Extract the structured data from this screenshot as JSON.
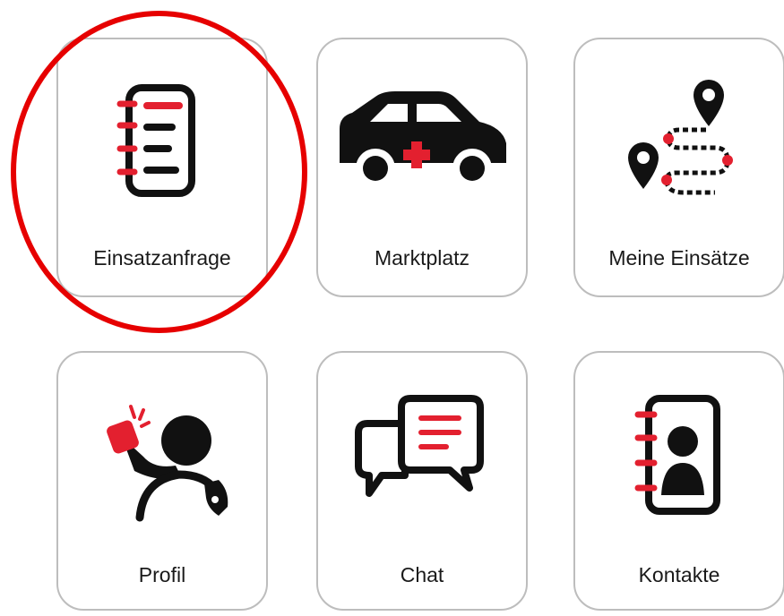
{
  "tiles": [
    {
      "label": "Einsatzanfrage",
      "icon": "request-list-icon"
    },
    {
      "label": "Marktplatz",
      "icon": "ambulance-car-icon"
    },
    {
      "label": "Meine Einsätze",
      "icon": "route-map-icon"
    },
    {
      "label": "Profil",
      "icon": "driver-profile-icon"
    },
    {
      "label": "Chat",
      "icon": "chat-bubbles-icon"
    },
    {
      "label": "Kontakte",
      "icon": "contact-book-icon"
    }
  ],
  "colors": {
    "accent": "#e3202f",
    "icon": "#111111",
    "highlight": "#e60000",
    "tile_border": "#bdbdbd"
  }
}
